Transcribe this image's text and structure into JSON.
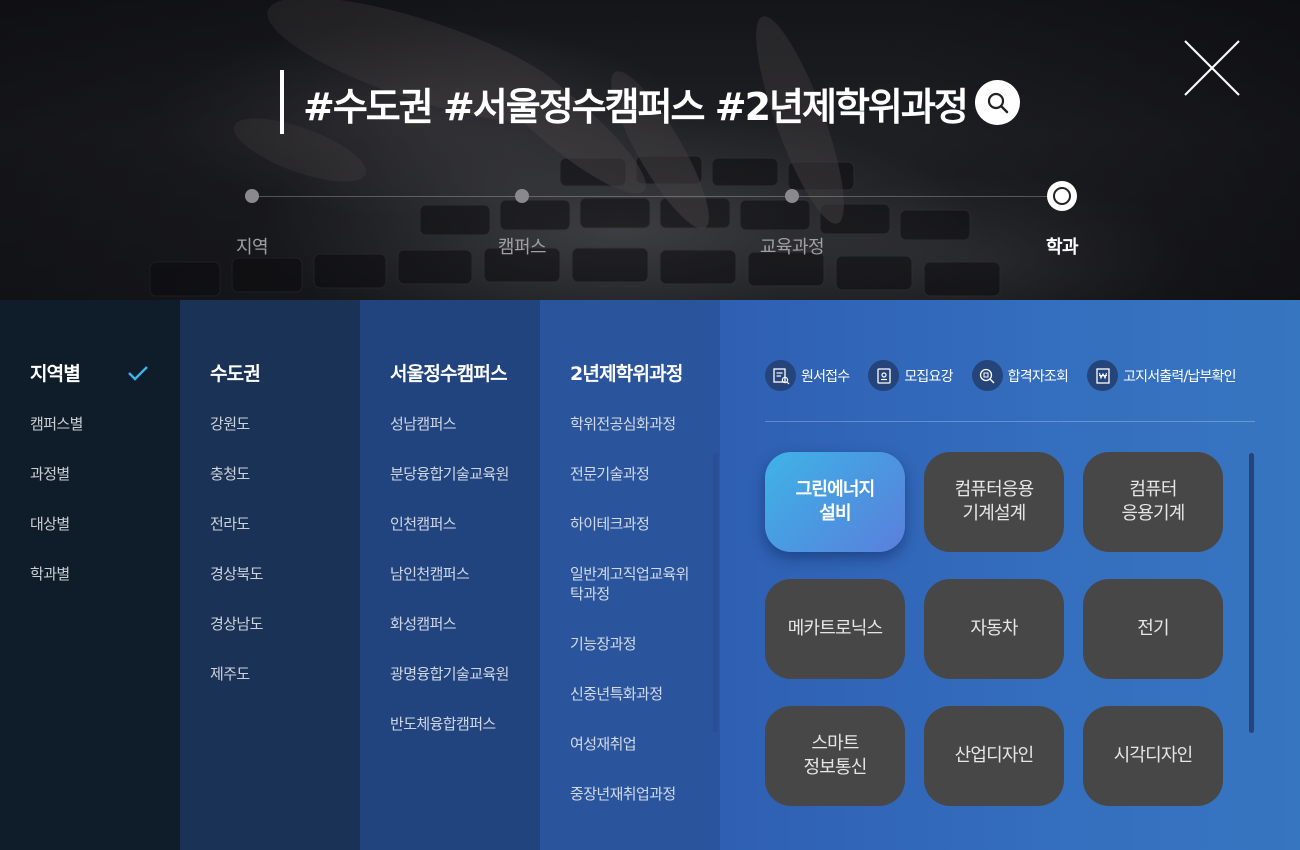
{
  "header": {
    "title": "#수도권 #서울정수캠퍼스 #2년제학위과정",
    "search_icon": "search-icon",
    "close_icon": "close-icon"
  },
  "steps": [
    {
      "label": "지역",
      "active": false
    },
    {
      "label": "캠퍼스",
      "active": false
    },
    {
      "label": "교육과정",
      "active": false
    },
    {
      "label": "학과",
      "active": true
    }
  ],
  "filters": {
    "head": "지역별",
    "items": [
      "캠퍼스별",
      "과정별",
      "대상별",
      "학과별"
    ]
  },
  "regions": {
    "head": "수도권",
    "items": [
      "강원도",
      "충청도",
      "전라도",
      "경상북도",
      "경상남도",
      "제주도"
    ]
  },
  "campuses": {
    "head": "서울정수캠퍼스",
    "items": [
      "성남캠퍼스",
      "분당융합기술교육원",
      "인천캠퍼스",
      "남인천캠퍼스",
      "화성캠퍼스",
      "광명융합기술교육원",
      "반도체융합캠퍼스"
    ]
  },
  "courses": {
    "head": "2년제학위과정",
    "items": [
      "학위전공심화과정",
      "전문기술과정",
      "하이테크과정",
      "일반계고직업교육위탁과정",
      "기능장과정",
      "신중년특화과정",
      "여성재취업",
      "중장년재취업과정"
    ]
  },
  "quick_links": [
    {
      "label": "원서접수",
      "icon": "application-form-icon"
    },
    {
      "label": "모집요강",
      "icon": "guide-document-icon"
    },
    {
      "label": "합격자조회",
      "icon": "search-result-icon"
    },
    {
      "label": "고지서출력/납부확인",
      "icon": "bill-payment-icon"
    }
  ],
  "departments": [
    {
      "label": "그린에너지\n설비",
      "active": true
    },
    {
      "label": "컴퓨터응용\n기계설계",
      "active": false
    },
    {
      "label": "컴퓨터\n응용기계",
      "active": false
    },
    {
      "label": "메카트로닉스",
      "active": false
    },
    {
      "label": "자동차",
      "active": false
    },
    {
      "label": "전기",
      "active": false
    },
    {
      "label": "스마트\n정보통신",
      "active": false
    },
    {
      "label": "산업디자인",
      "active": false
    },
    {
      "label": "시각디자인",
      "active": false
    }
  ],
  "colors": {
    "active_gradient_start": "#3fb3e8",
    "active_gradient_end": "#5b7fdc",
    "dept_bg": "#474747"
  }
}
